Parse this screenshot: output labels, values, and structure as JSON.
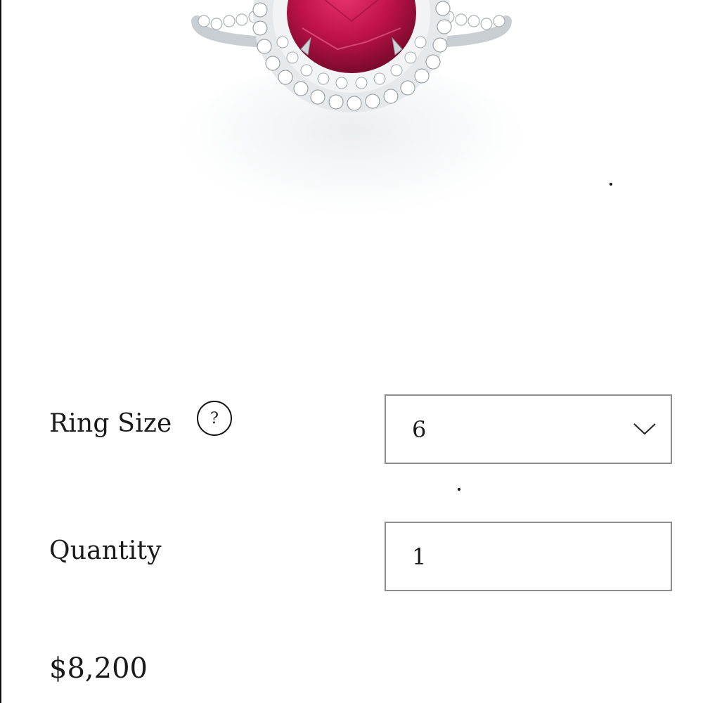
{
  "product": {
    "image_alt": "Ruby halo diamond ring",
    "icons": {
      "help": "question-circle-icon",
      "dropdown": "chevron-down-icon"
    },
    "colors": {
      "gem": "#c0124a",
      "metal": "#cfd4d8",
      "field_border": "#8e8e8e"
    }
  },
  "ring_size": {
    "label": "Ring Size",
    "help_glyph": "?",
    "selected": "6"
  },
  "quantity": {
    "label": "Quantity",
    "value": "1"
  },
  "price": "$8,200"
}
